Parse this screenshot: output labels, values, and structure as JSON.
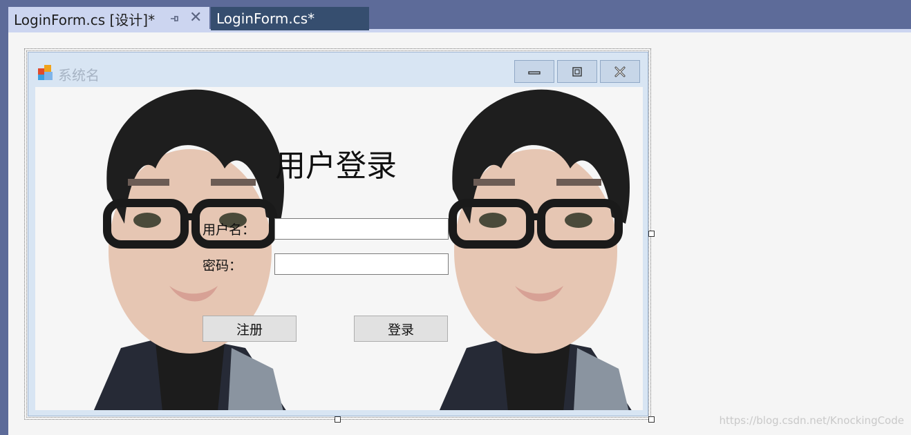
{
  "ide": {
    "tabs": [
      {
        "label": "LoginForm.cs [设计]*",
        "active": true
      },
      {
        "label": "LoginForm.cs*",
        "active": false
      }
    ],
    "pin_icon": "pin-icon",
    "close_icon": "close-icon"
  },
  "form": {
    "title": "系统名",
    "heading": "用户登录",
    "username_label": "用户名：",
    "password_label": "密码：",
    "username_value": "",
    "password_value": "",
    "register_button": "注册",
    "login_button": "登录"
  },
  "watermark": "https://blog.csdn.net/KnockingCode",
  "colors": {
    "ide_tabstrip": "#5d6b99",
    "active_tab": "#ccd5f0",
    "inactive_tab": "#364e6f",
    "form_border": "#d8e5f3"
  }
}
